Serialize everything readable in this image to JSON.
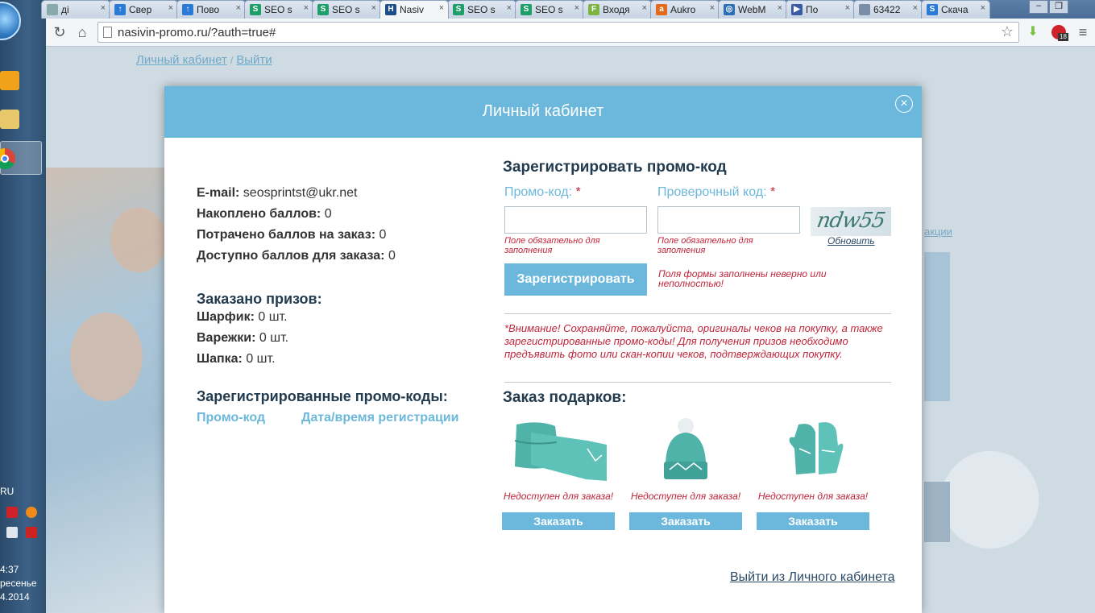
{
  "taskbar": {
    "lang": "RU",
    "time": "4:37",
    "day": "ресенье",
    "date": "4.2014"
  },
  "browser": {
    "tabs": [
      {
        "label": "ді",
        "icon": "page-icon"
      },
      {
        "label": "Свер",
        "icon": "arrow-up-icon"
      },
      {
        "label": "Пово",
        "icon": "arrow-up-icon"
      },
      {
        "label": "SEO s",
        "icon": "seo-sprint-icon"
      },
      {
        "label": "SEO s",
        "icon": "seo-sprint-icon"
      },
      {
        "label": "Nasiv",
        "icon": "nasivin-icon",
        "active": true
      },
      {
        "label": "SEO s",
        "icon": "seo-sprint-icon"
      },
      {
        "label": "SEO s",
        "icon": "seo-sprint-icon"
      },
      {
        "label": "Входя",
        "icon": "mail-f-icon"
      },
      {
        "label": "Aukro",
        "icon": "aukro-icon"
      },
      {
        "label": "WebM",
        "icon": "globe-icon"
      },
      {
        "label": "По",
        "icon": "video-icon"
      },
      {
        "label": "63422",
        "icon": "image-icon"
      },
      {
        "label": "Скача",
        "icon": "download-site-icon"
      }
    ],
    "url": "nasivin-promo.ru/?auth=true#",
    "extension_badge": "18"
  },
  "page": {
    "breadcrumb_cabinet": "Личный кабинет",
    "breadcrumb_logout": "Выйти",
    "side_link": "акции"
  },
  "modal": {
    "title": "Личный кабинет",
    "account": {
      "email_label": "E-mail:",
      "email_value": "seosprintst@ukr.net",
      "earned_label": "Накоплено баллов:",
      "earned_value": "0",
      "spent_label": "Потрачено баллов на заказ:",
      "spent_value": "0",
      "available_label": "Доступно баллов для заказа:",
      "available_value": "0"
    },
    "prizes": {
      "heading": "Заказано призов:",
      "items": [
        {
          "label": "Шарфик:",
          "value": "0 шт."
        },
        {
          "label": "Варежки:",
          "value": "0 шт."
        },
        {
          "label": "Шапка:",
          "value": "0 шт."
        }
      ]
    },
    "registered_codes": {
      "heading": "Зарегистрированные промо-коды:",
      "col_code": "Промо-код",
      "col_date": "Дата/время регистрации"
    },
    "register_form": {
      "heading": "Зарегистрировать промо-код",
      "promo_label": "Промо-код:",
      "check_label": "Проверочный код:",
      "required_mark": "*",
      "promo_value": "",
      "check_value": "",
      "field_error": "Поле обязательно для заполнения",
      "captcha_text": "ndw55",
      "captcha_refresh": "Обновить",
      "submit_label": "Зарегистрировать",
      "form_error": "Поля формы заполнены неверно или неполностью!",
      "notice": "*Внимание! Сохраняйте, пожалуйста, оригиналы чеков на покупку, а также зарегистрированные промо-коды! Для получения призов необходимо предъявить фото или скан-копии чеков, подтверждающих покупку."
    },
    "gifts": {
      "heading": "Заказ подарков:",
      "items": [
        {
          "name": "scarf",
          "status": "Недоступен для заказа!",
          "button": "Заказать"
        },
        {
          "name": "hat",
          "status": "Недоступен для заказа!",
          "button": "Заказать"
        },
        {
          "name": "mittens",
          "status": "Недоступен для заказа!",
          "button": "Заказать"
        }
      ]
    },
    "logout_link": "Выйти из Личного кабинета"
  },
  "colors": {
    "accent": "#6cb8dc",
    "heading": "#223b4f",
    "error": "#c0253a",
    "gift_teal": "#4fb3a9"
  }
}
